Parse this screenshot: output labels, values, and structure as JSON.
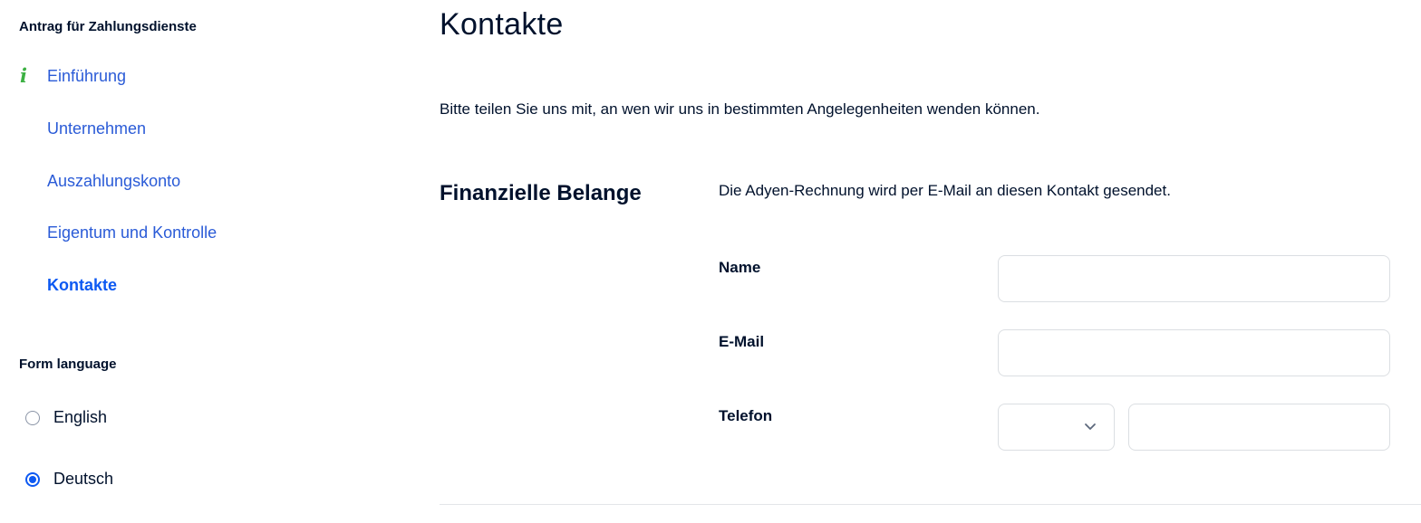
{
  "sidebar": {
    "title": "Antrag für Zahlungsdienste",
    "items": [
      {
        "label": "Einführung"
      },
      {
        "label": "Unternehmen"
      },
      {
        "label": "Auszahlungskonto"
      },
      {
        "label": "Eigentum und Kontrolle"
      },
      {
        "label": "Kontakte"
      }
    ],
    "active_item": "Kontakte",
    "info_icon": "info-icon",
    "form_language": {
      "title": "Form language",
      "options": [
        {
          "label": "English",
          "checked": false
        },
        {
          "label": "Deutsch",
          "checked": true
        }
      ]
    }
  },
  "main": {
    "title": "Kontakte",
    "intro": "Bitte teilen Sie uns mit, an wen wir uns in bestimmten Angelegenheiten wenden können.",
    "section": {
      "title": "Finanzielle Belange",
      "description": "Die Adyen-Rechnung wird per E-Mail an diesen Kontakt gesendet.",
      "fields": {
        "name_label": "Name",
        "name_value": "",
        "email_label": "E-Mail",
        "email_value": "",
        "phone_label": "Telefon",
        "phone_code_value": "",
        "phone_number_value": ""
      }
    }
  },
  "colors": {
    "accent": "#0d59f2",
    "link": "#2a5bd7",
    "info_green": "#3cb043",
    "text": "#00112c",
    "border": "#dbdee2"
  }
}
